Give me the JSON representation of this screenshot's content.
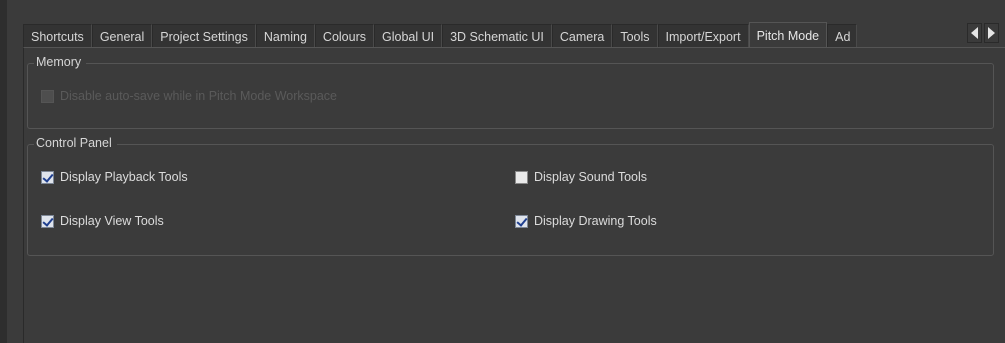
{
  "tabs": [
    {
      "label": "Shortcuts",
      "active": false
    },
    {
      "label": "General",
      "active": false
    },
    {
      "label": "Project Settings",
      "active": false
    },
    {
      "label": "Naming",
      "active": false
    },
    {
      "label": "Colours",
      "active": false
    },
    {
      "label": "Global UI",
      "active": false
    },
    {
      "label": "3D Schematic UI",
      "active": false
    },
    {
      "label": "Camera",
      "active": false
    },
    {
      "label": "Tools",
      "active": false
    },
    {
      "label": "Import/Export",
      "active": false
    },
    {
      "label": "Pitch Mode",
      "active": true
    },
    {
      "label": "Ad",
      "active": false
    }
  ],
  "memory": {
    "title": "Memory",
    "disable_autosave": {
      "label": "Disable auto-save while in Pitch Mode Workspace",
      "checked": false,
      "enabled": false
    }
  },
  "control_panel": {
    "title": "Control Panel",
    "playback_tools": {
      "label": "Display Playback Tools",
      "checked": true
    },
    "sound_tools": {
      "label": "Display Sound Tools",
      "checked": false
    },
    "view_tools": {
      "label": "Display View Tools",
      "checked": true
    },
    "drawing_tools": {
      "label": "Display Drawing Tools",
      "checked": true
    }
  },
  "icons": {
    "scroll_left": "arrow-left-icon",
    "scroll_right": "arrow-right-icon"
  }
}
